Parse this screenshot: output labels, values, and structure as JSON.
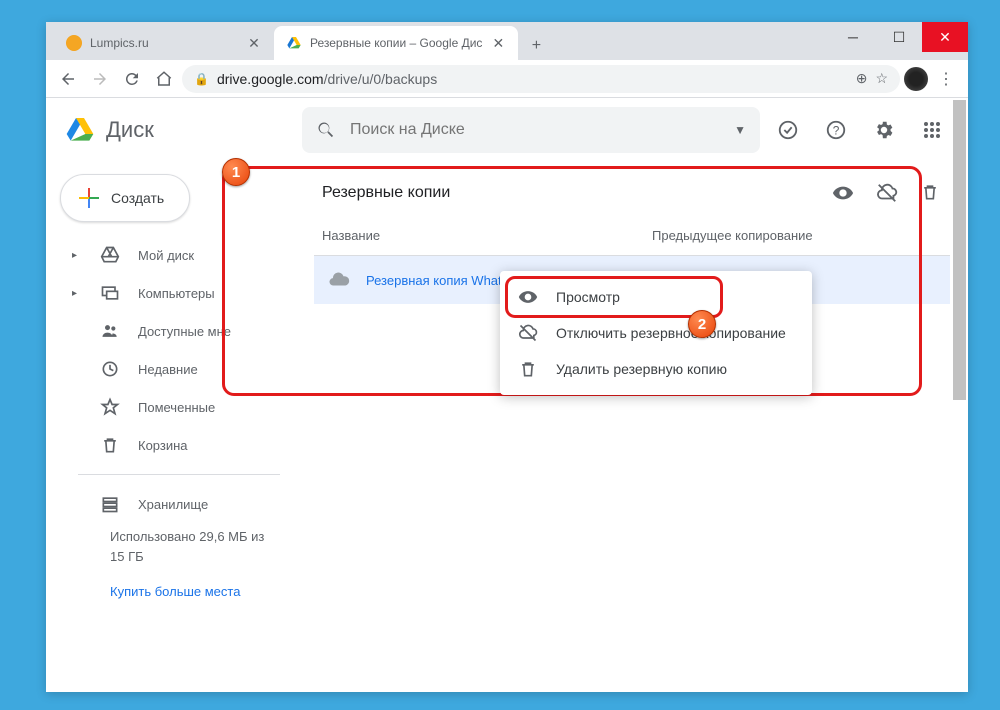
{
  "browser": {
    "tabs": [
      {
        "title": "Lumpics.ru",
        "favicon_color": "#f5a623"
      },
      {
        "title": "Резервные копии – Google Дис",
        "favicon": "drive"
      }
    ],
    "url_domain": "drive.google.com",
    "url_path": "/drive/u/0/backups"
  },
  "app": {
    "name": "Диск",
    "search_placeholder": "Поиск на Диске",
    "create_label": "Создать"
  },
  "sidebar": {
    "items": [
      {
        "label": "Мой диск",
        "icon": "mydrive",
        "arrow": true
      },
      {
        "label": "Компьютеры",
        "icon": "computers",
        "arrow": true
      },
      {
        "label": "Доступные мне",
        "icon": "shared",
        "arrow": false
      },
      {
        "label": "Недавние",
        "icon": "recent",
        "arrow": false
      },
      {
        "label": "Помеченные",
        "icon": "starred",
        "arrow": false
      },
      {
        "label": "Корзина",
        "icon": "trash",
        "arrow": false
      }
    ],
    "storage_label": "Хранилище",
    "storage_used": "Использовано 29,6 МБ из 15 ГБ",
    "buy_more": "Купить больше места"
  },
  "main": {
    "title": "Резервные копии",
    "columns": {
      "name": "Название",
      "prev": "Предыдущее копирование"
    },
    "row": {
      "name": "Резервная копия WhatsApp ("
    }
  },
  "context_menu": {
    "view": "Просмотр",
    "disable": "Отключить резервное копирование",
    "delete": "Удалить резервную копию"
  },
  "callouts": {
    "one": "1",
    "two": "2"
  }
}
